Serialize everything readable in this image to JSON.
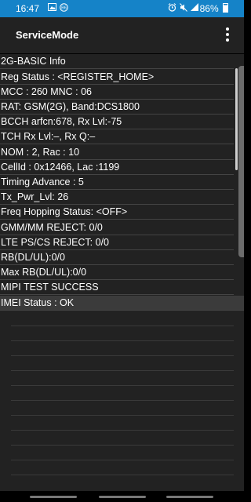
{
  "status_bar": {
    "time": "16:47",
    "battery": "86%",
    "icons": [
      "image-icon",
      "notification-icon",
      "alarm-icon",
      "mute-icon",
      "signal-icon",
      "battery-icon"
    ]
  },
  "app_bar": {
    "title": "ServiceMode",
    "menu_icon": "more-vert-icon"
  },
  "rows": [
    "2G-BASIC Info",
    "Reg Status : <REGISTER_HOME>",
    "MCC : 260 MNC : 06",
    "RAT: GSM(2G), Band:DCS1800",
    "BCCH arfcn:678, Rx Lvl:-75",
    "TCH Rx Lvl:–, Rx Q:–",
    "NOM : 2, Rac : 10",
    "CellId : 0x12466, Lac :1199",
    "Timing Advance : 5",
    "Tx_Pwr_Lvl: 26",
    "Freq Hopping Status: <OFF>",
    "GMM/MM REJECT: 0/0",
    "LTE PS/CS REJECT: 0/0",
    "RB(DL/UL):0/0",
    "Max RB(DL/UL):0/0",
    "MIPI TEST SUCCESS",
    "IMEI Status : OK"
  ],
  "colors": {
    "status_bar": "#1583c8",
    "background": "#222222",
    "highlight_row": "#3b3b3b"
  }
}
